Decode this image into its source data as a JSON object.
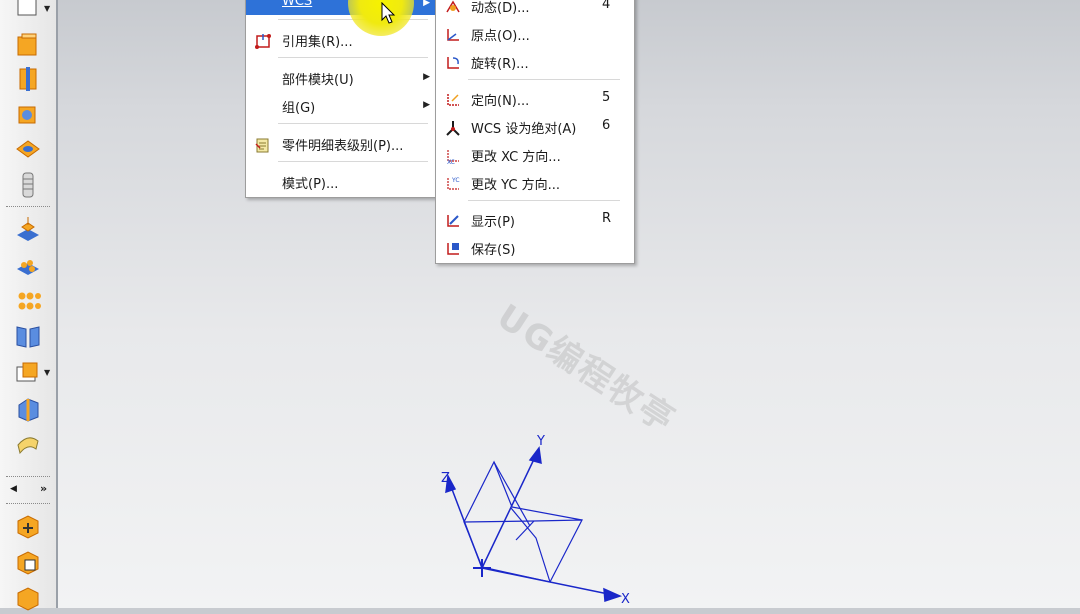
{
  "main_menu": {
    "wcs_label": "WCS",
    "items": [
      {
        "label": "引用集(R)...",
        "icon": "reference-set-icon"
      },
      {
        "label": "部件模块(U)",
        "has_submenu": true
      },
      {
        "label": "组(G)",
        "has_submenu": true
      },
      {
        "label": "零件明细表级别(P)...",
        "icon": "parts-list-icon"
      },
      {
        "label": "模式(P)..."
      }
    ]
  },
  "wcs_menu": {
    "items": [
      {
        "label": "动态(D)...",
        "shortcut": "4",
        "icon": "wcs-dynamic-icon"
      },
      {
        "label": "原点(O)...",
        "shortcut": "",
        "icon": "wcs-origin-icon"
      },
      {
        "label": "旋转(R)...",
        "shortcut": "",
        "icon": "wcs-rotate-icon"
      },
      {
        "label": "定向(N)...",
        "shortcut": "5",
        "icon": "wcs-orient-icon"
      },
      {
        "label": "WCS 设为绝对(A)",
        "shortcut": "6",
        "icon": "wcs-absolute-icon"
      },
      {
        "label": "更改 XC 方向...",
        "shortcut": "",
        "icon": "change-xc-icon"
      },
      {
        "label": "更改 YC 方向...",
        "shortcut": "",
        "icon": "change-yc-icon"
      },
      {
        "label": "显示(P)",
        "shortcut": "R",
        "icon": "wcs-display-icon"
      },
      {
        "label": "保存(S)",
        "shortcut": "",
        "icon": "wcs-save-icon"
      }
    ]
  },
  "axes": {
    "x": "X",
    "y": "Y",
    "z": "Z"
  },
  "watermark": "UG编程牧亭",
  "colors": {
    "highlight": "#2e72d8",
    "axis": "#1a27c9",
    "icon_orange": "#f0a020"
  }
}
